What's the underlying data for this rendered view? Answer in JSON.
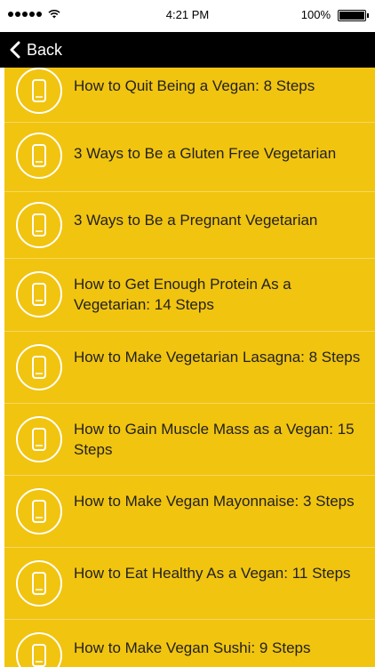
{
  "status_bar": {
    "time": "4:21 PM",
    "battery": "100%"
  },
  "nav": {
    "back_label": "Back"
  },
  "list": {
    "items": [
      "How to Quit Being a Vegan: 8 Steps",
      "3 Ways to Be a Gluten Free Vegetarian",
      "3 Ways to Be a Pregnant Vegetarian",
      "How to Get Enough Protein As a Vegetarian: 14 Steps",
      "How to Make Vegetarian Lasagna: 8 Steps",
      "How to Gain Muscle Mass as a Vegan: 15 Steps",
      "How to Make Vegan Mayonnaise: 3 Steps",
      "How to Eat Healthy As a Vegan: 11 Steps",
      "How to Make Vegan Sushi: 9 Steps"
    ],
    "icon": "smartphone-icon"
  },
  "colors": {
    "accent": "#f1c40f",
    "nav_bg": "#000000",
    "divider": "#f7dc6f"
  }
}
